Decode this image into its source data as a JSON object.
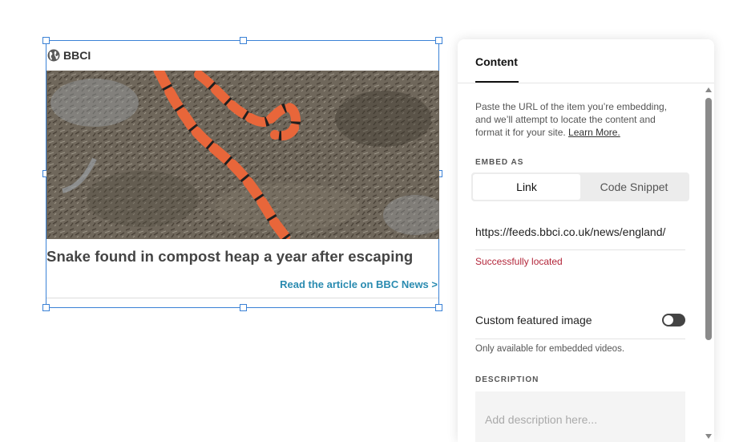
{
  "embed": {
    "provider": "BBCI",
    "title": "Snake found in compost heap a year after escaping",
    "read_link": "Read the article on BBC News >"
  },
  "panel": {
    "tab": "Content",
    "help_text": "Paste the URL of the item you’re embedding, and we’ll attempt to locate the content and format it for your site.",
    "learn_more": "Learn More.",
    "embed_as_label": "EMBED AS",
    "embed_as_options": [
      "Link",
      "Code Snippet"
    ],
    "embed_as_selected": "Link",
    "url_value": "https://feeds.bbci.co.uk/news/england/",
    "status": "Successfully located",
    "custom_image_label": "Custom featured image",
    "custom_image_enabled": false,
    "custom_image_help": "Only available for embedded videos.",
    "description_label": "DESCRIPTION",
    "description_placeholder": "Add description here..."
  },
  "colors": {
    "selection": "#3b82d6",
    "link": "#2a8bb0",
    "status": "#b3263a",
    "snake_orange": "#e8663a"
  },
  "icons": {
    "provider": "globe-icon",
    "toggle": "toggle-switch"
  }
}
